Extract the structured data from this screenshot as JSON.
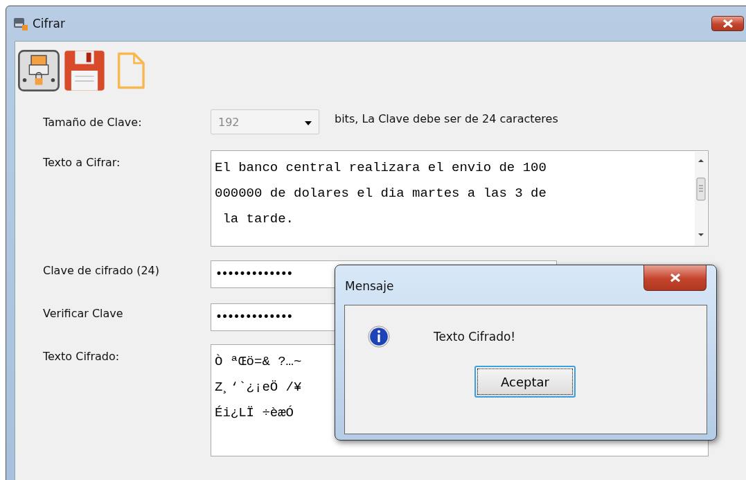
{
  "window": {
    "title": "Cifrar"
  },
  "toolbar": [
    {
      "kind": "encrypt"
    },
    {
      "kind": "save"
    },
    {
      "kind": "new"
    }
  ],
  "form": {
    "key_size": {
      "label": "Tamaño de Clave:",
      "value": "192",
      "disabled": true,
      "note": "bits, La Clave debe ser de 24 caracteres"
    },
    "plain_text": {
      "label": "Texto a Cifrar:",
      "lines": [
        "El banco central realizara el envio de 100",
        "000000 de dolares el dia martes a las 3 de",
        " la tarde."
      ]
    },
    "key": {
      "label": "Clave de cifrado (24)",
      "value": "•••••••••••••"
    },
    "verify": {
      "label": "Verificar Clave",
      "value": "•••••••••••••"
    },
    "cipher_text": {
      "label": "Texto Cifrado:",
      "lines": [
        "Ò ªŒö=& ?…~",
        "Z¸‘`¿¡eÖ /¥",
        "Éi¿LÏ ÷èæÓ"
      ]
    }
  },
  "dialog": {
    "title": "Mensaje",
    "message": "Texto Cifrado!",
    "button": {
      "label": "Aceptar",
      "focused": true
    }
  }
}
